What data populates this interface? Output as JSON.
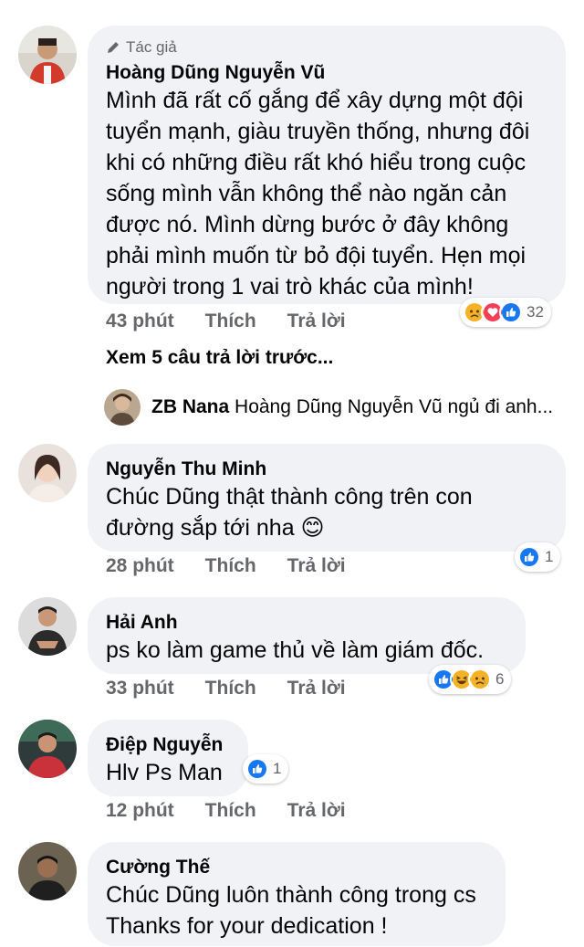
{
  "comments": [
    {
      "badge": "Tác giả",
      "name": "Hoàng Dũng Nguyễn Vũ",
      "lines": [
        "Mình đã rất cố gắng để xây dựng một đội",
        "tuyển mạnh, giàu truyền thống, nhưng đôi",
        "khi có những điều rất khó hiểu trong cuộc",
        "sống mình vẫn không thể nào ngăn cản",
        "được nó. Mình dừng bước ở đây không",
        "phải mình muốn từ bỏ đội tuyển. Hẹn mọi",
        "người trong 1 vai trò khác của mình!"
      ],
      "time": "43 phút",
      "like": "Thích",
      "reply": "Trả lời",
      "reactions": [
        "sad",
        "love",
        "like"
      ],
      "reaction_count": "32"
    },
    {
      "name": "Nguyễn Thu Minh",
      "lines": [
        "Chúc Dũng thật thành công trên con",
        "đường sắp tới nha 😊"
      ],
      "time": "28 phút",
      "like": "Thích",
      "reply": "Trả lời",
      "reactions": [
        "like"
      ],
      "reaction_count": "1"
    },
    {
      "name": "Hải Anh",
      "lines": [
        "ps ko làm game thủ về làm giám đốc."
      ],
      "time": "33 phút",
      "like": "Thích",
      "reply": "Trả lời",
      "reactions": [
        "like",
        "haha",
        "sad"
      ],
      "reaction_count": "6"
    },
    {
      "name": "Điệp Nguyễn",
      "lines": [
        "Hlv Ps Man"
      ],
      "time": "12 phút",
      "like": "Thích",
      "reply": "Trả lời",
      "reactions": [
        "like"
      ],
      "reaction_count": "1"
    },
    {
      "name": "Cường Thế",
      "lines": [
        "Chúc Dũng luôn thành công trong cs",
        "Thanks for your dedication !"
      ]
    }
  ],
  "view_previous": "Xem 5 câu trả lời trước...",
  "reply_preview": {
    "name": "ZB Nana",
    "text": "Hoàng Dũng Nguyễn Vũ ngủ đi anh..."
  },
  "colors": {
    "bubble": "#f0f2f5",
    "meta": "#65676b",
    "like_blue": "#1877f2",
    "love_red": "#f33e58",
    "emoji_yellow": "#f7b125"
  }
}
